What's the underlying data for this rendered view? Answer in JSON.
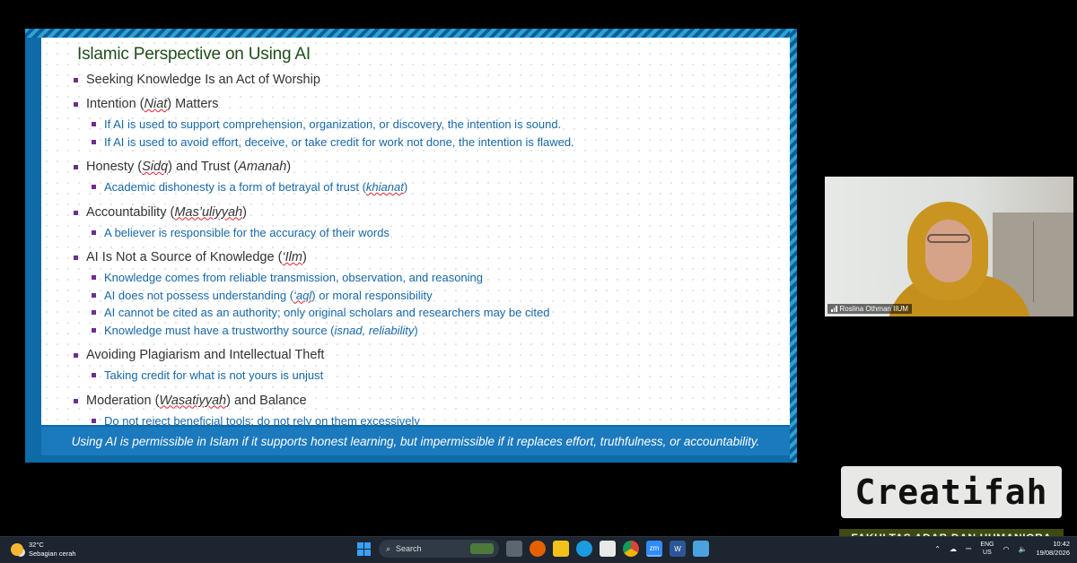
{
  "slide": {
    "title": "Islamic Perspective on Using AI",
    "sections": [
      {
        "heading": [
          {
            "t": "Seeking Knowledge Is an Act of Worship"
          }
        ],
        "subs": []
      },
      {
        "heading": [
          {
            "t": "Intention ("
          },
          {
            "t": "Niat",
            "it": true,
            "ul": true
          },
          {
            "t": ") Matters"
          }
        ],
        "subs": [
          [
            {
              "t": "If AI is used to support comprehension, organization, or discovery, the intention is sound."
            }
          ],
          [
            {
              "t": "If AI is used to avoid effort, deceive, or take credit for work not done, the intention is flawed."
            }
          ]
        ]
      },
      {
        "heading": [
          {
            "t": "Honesty ("
          },
          {
            "t": "Sidq",
            "it": true,
            "ul": true
          },
          {
            "t": ") and Trust ("
          },
          {
            "t": "Amanah",
            "it": true
          },
          {
            "t": ")"
          }
        ],
        "subs": [
          [
            {
              "t": "Academic dishonesty is a form of betrayal of trust ("
            },
            {
              "t": "khianat",
              "it": true,
              "ul": true
            },
            {
              "t": ")"
            }
          ]
        ]
      },
      {
        "heading": [
          {
            "t": "Accountability ("
          },
          {
            "t": "Mas’uliyyah",
            "it": true,
            "ul": true
          },
          {
            "t": ")"
          }
        ],
        "subs": [
          [
            {
              "t": "A believer is responsible for the accuracy of their words"
            }
          ]
        ]
      },
      {
        "heading": [
          {
            "t": "AI Is Not a Source of Knowledge ("
          },
          {
            "t": "‘Ilm",
            "it": true,
            "ul": true
          },
          {
            "t": ")"
          }
        ],
        "subs": [
          [
            {
              "t": "Knowledge comes from reliable transmission, observation, and reasoning"
            }
          ],
          [
            {
              "t": "AI does not possess understanding ("
            },
            {
              "t": "‘aql",
              "it": true,
              "ul": true
            },
            {
              "t": ") or moral responsibility"
            }
          ],
          [
            {
              "t": "AI cannot be cited as an authority; only original scholars and researchers may be cited"
            }
          ],
          [
            {
              "t": "Knowledge must have a trustworthy source ("
            },
            {
              "t": "isnad, reliability",
              "it": true
            },
            {
              "t": ")"
            }
          ]
        ]
      },
      {
        "heading": [
          {
            "t": "Avoiding Plagiarism and Intellectual Theft"
          }
        ],
        "subs": [
          [
            {
              "t": "Taking credit for what is not yours is unjust"
            }
          ]
        ]
      },
      {
        "heading": [
          {
            "t": "Moderation ("
          },
          {
            "t": "Wasatiyyah",
            "it": true,
            "ul": true
          },
          {
            "t": ") and Balance"
          }
        ],
        "subs": [
          [
            {
              "t": "Do not reject beneficial tools; do not rely on them excessively"
            }
          ]
        ]
      }
    ],
    "footer": "Using AI is permissible in Islam if it supports honest learning, but impermissible if it replaces effort, truthfulness, or accountability."
  },
  "participant": {
    "name": "Roslina Othman IIUM"
  },
  "watermark": {
    "title": "Creatifah",
    "subtitle": "FAKULTAS ADAB DAN HUMANIORA"
  },
  "taskbar": {
    "weather_temp": "32°C",
    "weather_desc": "Sebagian cerah",
    "search_placeholder": "Search",
    "lang_top": "ENG",
    "lang_bottom": "US",
    "time": "10:42",
    "date": "19/08/2026",
    "apps": [
      "windows-icon",
      "search",
      "files-icon",
      "firefox-icon",
      "folder-icon",
      "edge-icon",
      "store-icon",
      "chrome-icon",
      "zoom-icon",
      "word-icon",
      "notepad-icon"
    ]
  }
}
